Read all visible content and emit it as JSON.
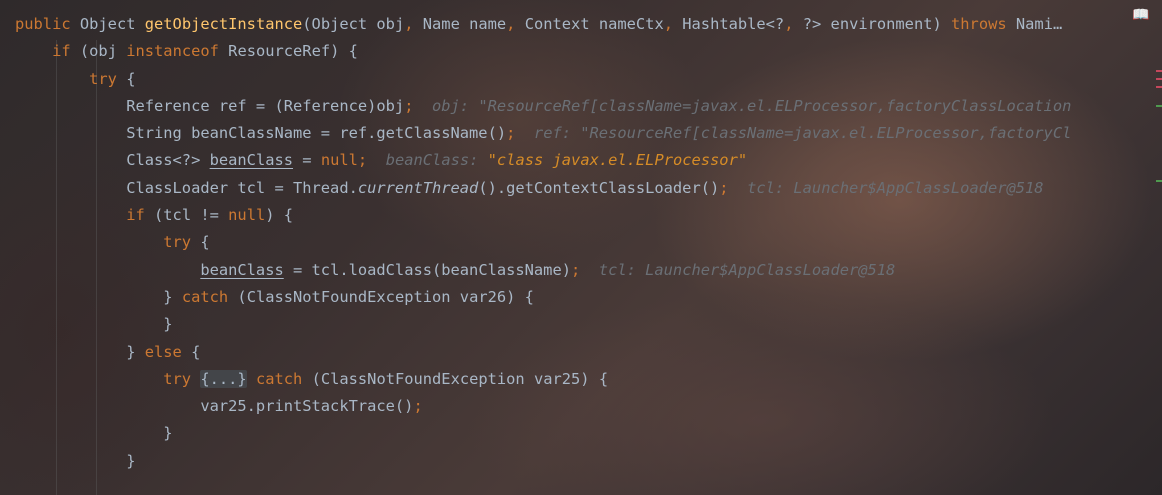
{
  "editor": {
    "book_icon": "book-icon",
    "lines": [
      {
        "indent": 0,
        "segments": [
          {
            "t": "public ",
            "c": "kw"
          },
          {
            "t": "Object ",
            "c": ""
          },
          {
            "t": "getObjectInstance",
            "c": "fn"
          },
          {
            "t": "(Object obj",
            "c": ""
          },
          {
            "t": ", ",
            "c": "kw"
          },
          {
            "t": "Name name",
            "c": ""
          },
          {
            "t": ", ",
            "c": "kw"
          },
          {
            "t": "Context nameCtx",
            "c": ""
          },
          {
            "t": ", ",
            "c": "kw"
          },
          {
            "t": "Hashtable<?",
            "c": ""
          },
          {
            "t": ", ",
            "c": "kw"
          },
          {
            "t": "?> environment) ",
            "c": ""
          },
          {
            "t": "throws ",
            "c": "kw"
          },
          {
            "t": "Nami…",
            "c": ""
          }
        ]
      },
      {
        "indent": 1,
        "segments": [
          {
            "t": "if ",
            "c": "kw"
          },
          {
            "t": "(obj ",
            "c": ""
          },
          {
            "t": "instanceof ",
            "c": "kw"
          },
          {
            "t": "ResourceRef) {",
            "c": ""
          }
        ]
      },
      {
        "indent": 2,
        "segments": [
          {
            "t": "try ",
            "c": "kw"
          },
          {
            "t": "{",
            "c": ""
          }
        ]
      },
      {
        "indent": 3,
        "segments": [
          {
            "t": "Reference ref = (Reference)obj",
            "c": ""
          },
          {
            "t": ";  ",
            "c": "kw"
          },
          {
            "t": "obj: \"ResourceRef[className=javax.el.ELProcessor,factoryClassLocation",
            "c": "hint"
          }
        ]
      },
      {
        "indent": 3,
        "segments": [
          {
            "t": "String beanClassName = ref.getClassName()",
            "c": ""
          },
          {
            "t": ";  ",
            "c": "kw"
          },
          {
            "t": "ref: \"ResourceRef[className=javax.el.ELProcessor,factoryCl",
            "c": "hint"
          }
        ]
      },
      {
        "indent": 3,
        "segments": [
          {
            "t": "Class<?> ",
            "c": ""
          },
          {
            "t": "beanClass",
            "c": "ul"
          },
          {
            "t": " = ",
            "c": ""
          },
          {
            "t": "null",
            "c": "kw"
          },
          {
            "t": ";  ",
            "c": "kw"
          },
          {
            "t": "beanClass: ",
            "c": "hint"
          },
          {
            "t": "\"class javax.el.ELProcessor\"",
            "c": "hintstr"
          }
        ]
      },
      {
        "indent": 3,
        "segments": [
          {
            "t": "ClassLoader tcl = Thread.",
            "c": ""
          },
          {
            "t": "currentThread",
            "c": "it"
          },
          {
            "t": "().getContextClassLoader()",
            "c": ""
          },
          {
            "t": ";  ",
            "c": "kw"
          },
          {
            "t": "tcl: Launcher$AppClassLoader@518",
            "c": "hint"
          }
        ]
      },
      {
        "indent": 3,
        "segments": [
          {
            "t": "if ",
            "c": "kw"
          },
          {
            "t": "(tcl != ",
            "c": ""
          },
          {
            "t": "null",
            "c": "kw"
          },
          {
            "t": ") {",
            "c": ""
          }
        ]
      },
      {
        "indent": 4,
        "segments": [
          {
            "t": "try ",
            "c": "kw"
          },
          {
            "t": "{",
            "c": ""
          }
        ]
      },
      {
        "indent": 5,
        "segments": [
          {
            "t": "beanClass",
            "c": "ul"
          },
          {
            "t": " = tcl.loadClass(beanClassName)",
            "c": ""
          },
          {
            "t": ";  ",
            "c": "kw"
          },
          {
            "t": "tcl: Launcher$AppClassLoader@518",
            "c": "hint"
          }
        ]
      },
      {
        "indent": 4,
        "segments": [
          {
            "t": "} ",
            "c": ""
          },
          {
            "t": "catch ",
            "c": "kw"
          },
          {
            "t": "(ClassNotFoundException var26) {",
            "c": ""
          }
        ]
      },
      {
        "indent": 4,
        "segments": [
          {
            "t": "}",
            "c": ""
          }
        ]
      },
      {
        "indent": 3,
        "segments": [
          {
            "t": "} ",
            "c": ""
          },
          {
            "t": "else ",
            "c": "kw"
          },
          {
            "t": "{",
            "c": ""
          }
        ]
      },
      {
        "indent": 4,
        "segments": [
          {
            "t": "try ",
            "c": "kw"
          },
          {
            "t": "{...}",
            "c": "fold"
          },
          {
            "t": " ",
            "c": ""
          },
          {
            "t": "catch ",
            "c": "kw"
          },
          {
            "t": "(ClassNotFoundException var25) {",
            "c": ""
          }
        ]
      },
      {
        "indent": 5,
        "segments": [
          {
            "t": "var25.printStackTrace()",
            "c": ""
          },
          {
            "t": ";",
            "c": "kw"
          }
        ]
      },
      {
        "indent": 4,
        "segments": [
          {
            "t": "}",
            "c": ""
          }
        ]
      },
      {
        "indent": 3,
        "segments": [
          {
            "t": "}",
            "c": ""
          }
        ]
      }
    ]
  },
  "colors": {
    "keyword": "#cc7832",
    "function": "#ffc66d",
    "text": "#a9b7c6",
    "hint": "#6a6f75",
    "hint_string": "#d68c27"
  }
}
